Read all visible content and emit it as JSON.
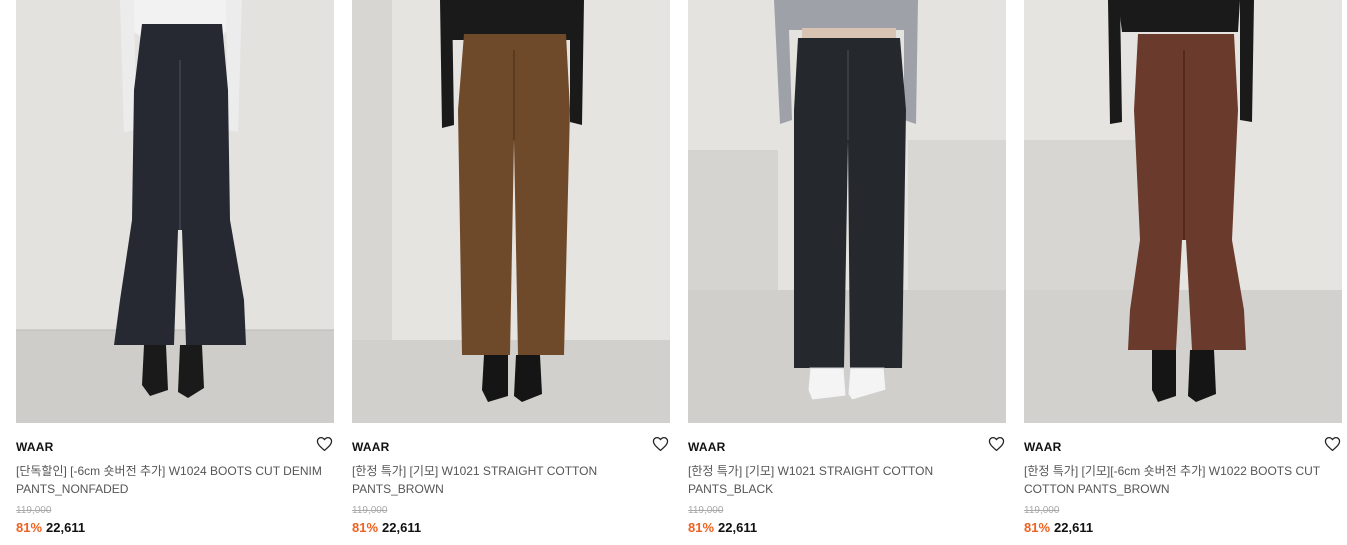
{
  "products": [
    {
      "brand": "WAAR",
      "title": "[단독할인] [-6cm 숏버전 추가] W1024 BOOTS CUT DENIM PANTS_NONFADED",
      "original_price": "119,000",
      "discount": "81%",
      "price": "22,611",
      "image": {
        "kind": "photo",
        "subject": "dark denim boots cut pants",
        "pants_color": "#262932",
        "top_color": "#f2f2f2",
        "shoes": "black boots",
        "bg_color": "#e3e2df"
      }
    },
    {
      "brand": "WAAR",
      "title": "[한정 특가] [기모] W1021 STRAIGHT COTTON PANTS_BROWN",
      "original_price": "119,000",
      "discount": "81%",
      "price": "22,611",
      "image": {
        "kind": "photo",
        "subject": "brown straight cotton pants",
        "pants_color": "#6f4a2a",
        "top_color": "#1a1a1a",
        "shoes": "black boots",
        "bg_color": "#e6e4e0"
      }
    },
    {
      "brand": "WAAR",
      "title": "[한정 특가] [기모] W1021 STRAIGHT COTTON PANTS_BLACK",
      "original_price": "119,000",
      "discount": "81%",
      "price": "22,611",
      "image": {
        "kind": "photo",
        "subject": "black straight cotton pants",
        "pants_color": "#25282d",
        "top_color": "#9ea2a8",
        "shoes": "white sneakers",
        "bg_color": "#e4e3e0"
      }
    },
    {
      "brand": "WAAR",
      "title": "[한정 특가] [기모][-6cm 숏버전 추가] W1022 BOOTS CUT COTTON PANTS_BROWN",
      "original_price": "119,000",
      "discount": "81%",
      "price": "22,611",
      "image": {
        "kind": "photo",
        "subject": "brown boots cut cotton pants",
        "pants_color": "#6a3a2c",
        "top_color": "#1a1a1a",
        "shoes": "black boots",
        "bg_color": "#e6e4e1"
      }
    }
  ],
  "colors": {
    "discount": "#f0601e",
    "original_price": "#aaaaaa",
    "title": "#555555"
  },
  "icons": {
    "like": "heart-outline-icon"
  }
}
